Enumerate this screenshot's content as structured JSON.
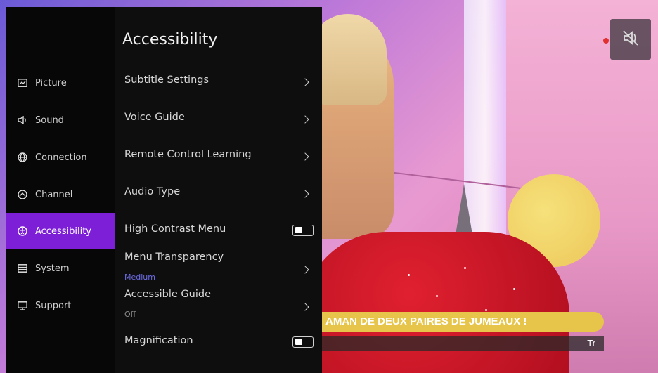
{
  "broadcast": {
    "ticker": "AMAN DE DEUX PAIRES DE JUMEAUX !",
    "subtitle_tag": "Tr",
    "mute_icon": "speaker-muted-icon"
  },
  "sidebar": {
    "items": [
      {
        "label": "Picture",
        "icon": "picture-icon"
      },
      {
        "label": "Sound",
        "icon": "speaker-icon"
      },
      {
        "label": "Connection",
        "icon": "globe-icon"
      },
      {
        "label": "Channel",
        "icon": "channel-icon"
      },
      {
        "label": "Accessibility",
        "icon": "accessibility-icon",
        "active": true
      },
      {
        "label": "System",
        "icon": "system-icon"
      },
      {
        "label": "Support",
        "icon": "support-icon"
      }
    ]
  },
  "menu": {
    "title": "Accessibility",
    "items": [
      {
        "label": "Subtitle Settings",
        "type": "submenu"
      },
      {
        "label": "Voice Guide",
        "type": "submenu"
      },
      {
        "label": "Remote Control Learning",
        "type": "submenu"
      },
      {
        "label": "Audio Type",
        "type": "submenu"
      },
      {
        "label": "High Contrast Menu",
        "type": "toggle"
      },
      {
        "label": "Menu Transparency",
        "value": "Medium",
        "type": "submenu"
      },
      {
        "label": "Accessible Guide",
        "value": "Off",
        "type": "submenu"
      },
      {
        "label": "Magnification",
        "type": "toggle"
      }
    ]
  },
  "colors": {
    "accent": "#7c1fd6",
    "value_text": "#6d6de8"
  }
}
